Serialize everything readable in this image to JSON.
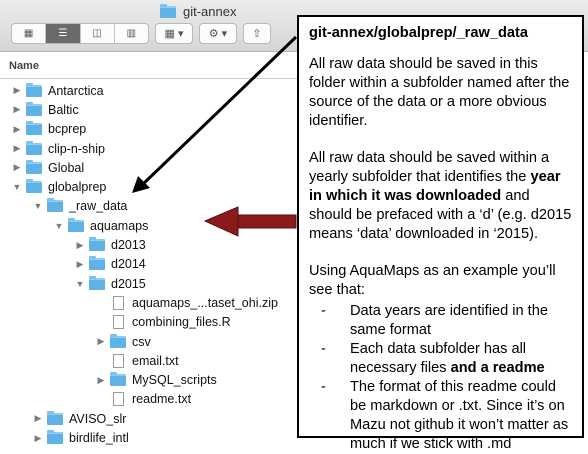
{
  "window": {
    "title": "git-annex"
  },
  "toolbar": {
    "items": [
      "icon-view",
      "list-view",
      "column-view",
      "cover-flow-view",
      "arrange",
      "action",
      "share"
    ]
  },
  "list": {
    "column_header": "Name",
    "rows": [
      {
        "label": "Antarctica",
        "kind": "folder",
        "indent": 0,
        "expanded": false
      },
      {
        "label": "Baltic",
        "kind": "folder",
        "indent": 0,
        "expanded": false
      },
      {
        "label": "bcprep",
        "kind": "folder",
        "indent": 0,
        "expanded": false
      },
      {
        "label": "clip-n-ship",
        "kind": "folder",
        "indent": 0,
        "expanded": false
      },
      {
        "label": "Global",
        "kind": "folder",
        "indent": 0,
        "expanded": false
      },
      {
        "label": "globalprep",
        "kind": "folder",
        "indent": 0,
        "expanded": true
      },
      {
        "label": "_raw_data",
        "kind": "folder",
        "indent": 1,
        "expanded": true
      },
      {
        "label": "aquamaps",
        "kind": "folder",
        "indent": 2,
        "expanded": true
      },
      {
        "label": "d2013",
        "kind": "folder",
        "indent": 3,
        "expanded": false
      },
      {
        "label": "d2014",
        "kind": "folder",
        "indent": 3,
        "expanded": false
      },
      {
        "label": "d2015",
        "kind": "folder",
        "indent": 3,
        "expanded": true
      },
      {
        "label": "aquamaps_...taset_ohi.zip",
        "kind": "file",
        "indent": 4
      },
      {
        "label": "combining_files.R",
        "kind": "file",
        "indent": 4
      },
      {
        "label": "csv",
        "kind": "folder",
        "indent": 4,
        "expanded": false
      },
      {
        "label": "email.txt",
        "kind": "file",
        "indent": 4
      },
      {
        "label": "MySQL_scripts",
        "kind": "folder",
        "indent": 4,
        "expanded": false
      },
      {
        "label": "readme.txt",
        "kind": "file",
        "indent": 4
      },
      {
        "label": "AVISO_slr",
        "kind": "folder",
        "indent": 1,
        "expanded": false
      },
      {
        "label": "birdlife_intl",
        "kind": "folder",
        "indent": 1,
        "expanded": false
      }
    ]
  },
  "annotation": {
    "title": "git-annex/globalprep/_raw_data",
    "p1": "All raw data should be saved in this folder within a subfolder named after the source of the data or a more obvious identifier.",
    "p2_before": "All raw data should be saved within a yearly subfolder that identifies the ",
    "p2_bold": "year in which it was downloaded",
    "p2_after": " and should be prefaced with a ‘d’ (e.g. d2015 means ‘data’ downloaded in ‘2015).",
    "p3": "Using AquaMaps as an example you’ll see that:",
    "bullet1": "Data years are identified in the same format",
    "bullet2_before": "Each data subfolder has all necessary files ",
    "bullet2_bold": "and a readme",
    "bullet3": "The format of this readme could be markdown or .txt. Since it’s on Mazu not github it won’t matter as much if we stick with .md"
  },
  "colors": {
    "folder": "#5fb2e6",
    "arrow_red": "#8b1a1a",
    "arrow_black": "#000000"
  }
}
